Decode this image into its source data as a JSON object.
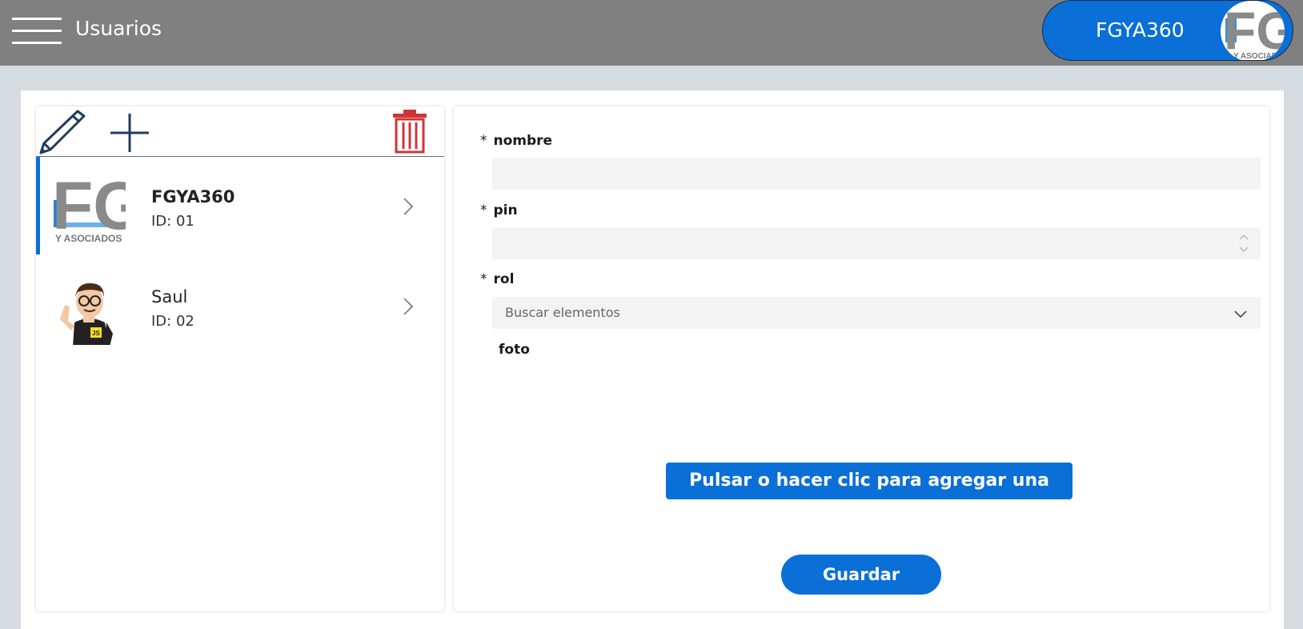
{
  "header": {
    "title": "Usuarios",
    "menu_icon": "hamburger-menu-icon",
    "user_label": "FGYA360",
    "logo_text": "FG",
    "logo_subtext": "Y ASOCIADOS"
  },
  "toolbar": {
    "edit_icon": "pencil-icon",
    "add_icon": "plus-icon",
    "delete_icon": "trash-icon"
  },
  "users": [
    {
      "name": "FGYA360",
      "id_label": "ID: 01",
      "avatar": "fg-logo",
      "selected": true
    },
    {
      "name": "Saul",
      "id_label": "ID: 02",
      "avatar": "cartoon-developer",
      "badge": "JS",
      "selected": false
    }
  ],
  "form": {
    "nombre": {
      "label": "nombre",
      "required_mark": "*",
      "value": ""
    },
    "pin": {
      "label": "pin",
      "required_mark": "*",
      "value": ""
    },
    "rol": {
      "label": "rol",
      "required_mark": "*",
      "placeholder": "Buscar elementos"
    },
    "foto": {
      "label": "foto"
    },
    "upload_label": "Pulsar o hacer clic para agregar una imagen",
    "save_label": "Guardar"
  },
  "colors": {
    "accent": "#0a6fd6",
    "topbar": "#808080",
    "delete": "#d13438",
    "icon_dark": "#1f3d5c"
  }
}
